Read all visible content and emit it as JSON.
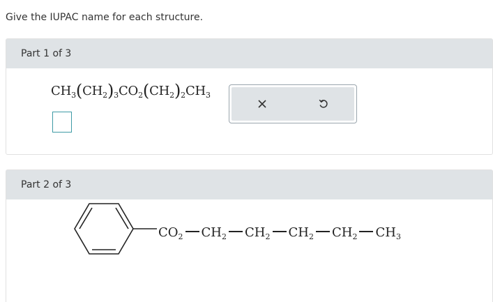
{
  "instruction": "Give the IUPAC name for each structure.",
  "part1": {
    "header": "Part 1 of 3",
    "formula": {
      "ch3_a": "CH",
      "sub3_a": "3",
      "open_a": "(",
      "ch2_a": "CH",
      "sub2_a": "2",
      "close_a": ")",
      "n_a": "3",
      "co": "CO",
      "sub2_co": "2",
      "open_b": "(",
      "ch2_b": "CH",
      "sub2_b": "2",
      "close_b": ")",
      "n_b": "2",
      "ch3_b": "CH",
      "sub3_b": "3"
    },
    "tools": {
      "clear_icon": "close-icon",
      "undo_icon": "undo-icon"
    }
  },
  "part2": {
    "header": "Part 2 of 3",
    "chain": [
      {
        "main": "CO",
        "sub": "2"
      },
      {
        "main": "CH",
        "sub": "2"
      },
      {
        "main": "CH",
        "sub": "2"
      },
      {
        "main": "CH",
        "sub": "2"
      },
      {
        "main": "CH",
        "sub": "2"
      },
      {
        "main": "CH",
        "sub": "3"
      }
    ]
  }
}
